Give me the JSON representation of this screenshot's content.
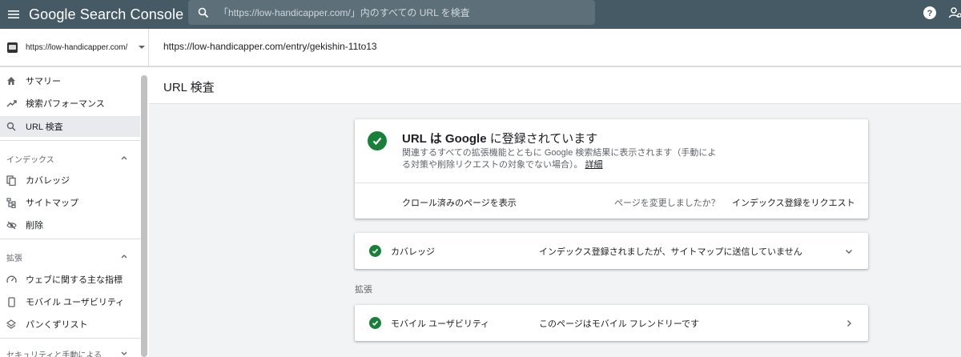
{
  "app": {
    "title_google": "Google",
    "title_rest": " Search Console"
  },
  "search": {
    "placeholder": "「https://low-handicapper.com/」内のすべての URL を検査"
  },
  "property": {
    "url": "https://low-handicapper.com/"
  },
  "inspected_url": "https://low-handicapper.com/entry/gekishin-11to13",
  "sidebar": {
    "items": [
      {
        "label": "サマリー",
        "icon": "home-icon"
      },
      {
        "label": "検索パフォーマンス",
        "icon": "trending-icon"
      },
      {
        "label": "URL 検査",
        "icon": "search-icon"
      }
    ],
    "index_section": "インデックス",
    "index_items": [
      {
        "label": "カバレッジ",
        "icon": "copy-icon"
      },
      {
        "label": "サイトマップ",
        "icon": "sitemap-icon"
      },
      {
        "label": "削除",
        "icon": "eye-off-icon"
      }
    ],
    "enhance_section": "拡張",
    "enhance_items": [
      {
        "label": "ウェブに関する主な指標",
        "icon": "speed-icon"
      },
      {
        "label": "モバイル ユーザビリティ",
        "icon": "phone-icon"
      },
      {
        "label": "パンくずリスト",
        "icon": "layers-icon"
      }
    ],
    "security_section": "セキュリティと手動による"
  },
  "page": {
    "title": "URL 検査"
  },
  "status": {
    "title_prefix": "URL は ",
    "title_google": "Google",
    "title_suffix": " に登録されています",
    "description": "関連するすべての拡張機能とともに Google 検索結果に表示されます（手動によ る対策や削除リクエストの対象でない場合）。",
    "details_link": "詳細",
    "crawl_link": "クロール済みのページを表示",
    "changed_question": "ページを変更しましたか？",
    "request_index": "インデックス登録をリクエスト"
  },
  "coverage": {
    "label": "カバレッジ",
    "value": "インデックス登録されましたが、サイトマップに送信していません"
  },
  "enhancements": {
    "section_label": "拡張",
    "mobile_label": "モバイル ユーザビリティ",
    "mobile_value": "このページはモバイル フレンドリーです"
  },
  "colors": {
    "topbar": "#455a64",
    "success": "#188038",
    "background": "#f1f3f4"
  }
}
